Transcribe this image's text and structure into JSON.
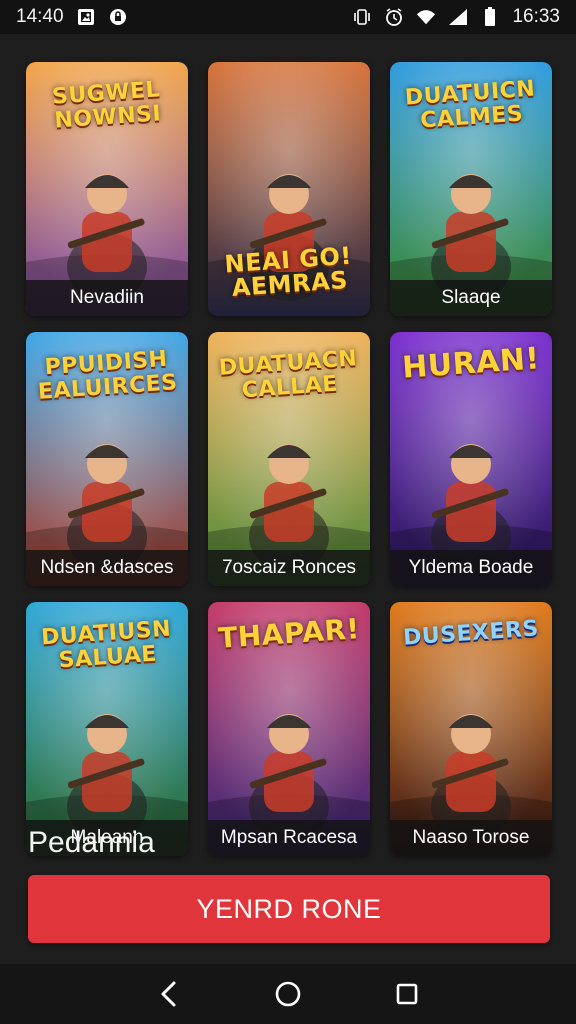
{
  "status_bar": {
    "left_time": "14:40",
    "right_time": "16:33",
    "left_icons": [
      "image-icon",
      "shield-icon"
    ],
    "right_icons": [
      "vibrate-icon",
      "alarm-icon",
      "wifi-icon",
      "signal-icon",
      "battery-icon"
    ]
  },
  "games": [
    {
      "art_title": "SUGWEL NOWNSI",
      "label": "Nevadiin",
      "colors": [
        "#f2a54a",
        "#7a4aa8"
      ]
    },
    {
      "art_title": "NEAI GO! AEMRAS",
      "label": "",
      "colors": [
        "#d8733a",
        "#2b2d4a"
      ]
    },
    {
      "art_title": "DUATUICN CALMES",
      "label": "Slaaqe",
      "colors": [
        "#2f9be0",
        "#3f8a2e"
      ]
    },
    {
      "art_title": "PPUIDISH EALUIRCES",
      "label": "Ndsen &dasces",
      "colors": [
        "#3fa7e6",
        "#b13f2a"
      ]
    },
    {
      "art_title": "DUATUACN CALLAE",
      "label": "7oscaiz Ronces",
      "colors": [
        "#f0b25a",
        "#4a8a3a"
      ]
    },
    {
      "art_title": "HURAN!",
      "label": "Yldema Boade",
      "colors": [
        "#7b2fd0",
        "#2a1a5a"
      ]
    },
    {
      "art_title": "DUATIUSN SALUAE",
      "label": "Maleann",
      "colors": [
        "#2fa7d8",
        "#2f6a2a"
      ]
    },
    {
      "art_title": "THAPAR!",
      "label": "Mpsan Rcacesa",
      "colors": [
        "#c43a6a",
        "#3a2a7a"
      ]
    },
    {
      "art_title": "DUSEXERS",
      "label": "Naaso Torose",
      "colors": [
        "#e07a1a",
        "#3a1a1a"
      ]
    }
  ],
  "section_title": "Pedannia",
  "primary_button": "YENRD RONE",
  "nav": {
    "icons": [
      "back-icon",
      "home-icon",
      "recents-icon"
    ]
  }
}
